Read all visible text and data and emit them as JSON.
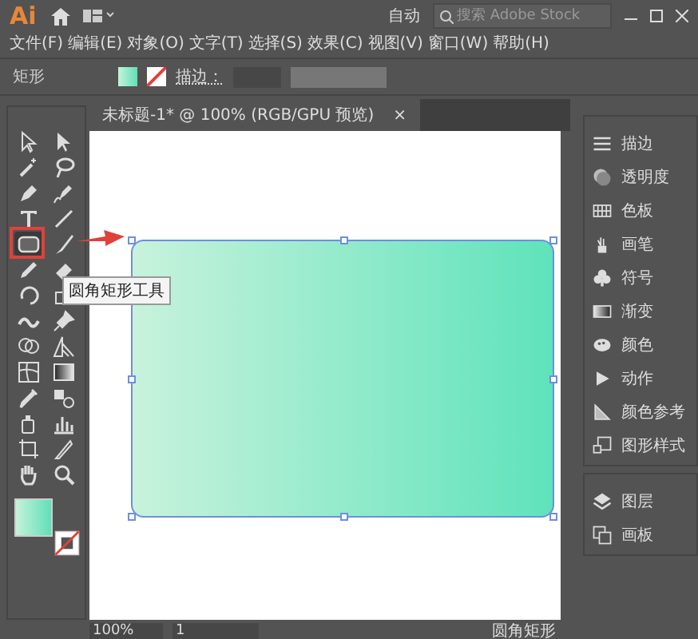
{
  "title_bar": {
    "logo": "Ai",
    "workspace": "自动",
    "search": {
      "placeholder": "搜索 Adobe Stock"
    }
  },
  "menu": [
    "文件(F)",
    "编辑(E)",
    "对象(O)",
    "文字(T)",
    "选择(S)",
    "效果(C)",
    "视图(V)",
    "窗口(W)",
    "帮助(H)"
  ],
  "control_bar": {
    "object_type": "矩形",
    "stroke_label": "描边："
  },
  "tools": [
    {
      "kind": "select",
      "selected": false
    },
    {
      "kind": "direct",
      "selected": false
    },
    {
      "kind": "wand",
      "selected": false
    },
    {
      "kind": "lasso",
      "selected": false
    },
    {
      "kind": "pen",
      "selected": false
    },
    {
      "kind": "curve",
      "selected": false
    },
    {
      "kind": "type",
      "selected": false
    },
    {
      "kind": "line",
      "selected": false
    },
    {
      "kind": "roundrect",
      "selected": true
    },
    {
      "kind": "brush",
      "selected": false
    },
    {
      "kind": "shaper",
      "selected": false
    },
    {
      "kind": "eraser",
      "selected": false
    },
    {
      "kind": "rotate",
      "selected": false
    },
    {
      "kind": "scale",
      "selected": false
    },
    {
      "kind": "warp",
      "selected": false
    },
    {
      "kind": "pin",
      "selected": false
    },
    {
      "kind": "builder",
      "selected": false
    },
    {
      "kind": "perspective",
      "selected": false
    },
    {
      "kind": "mesh",
      "selected": false
    },
    {
      "kind": "gradient",
      "selected": false
    },
    {
      "kind": "eyedropper",
      "selected": false
    },
    {
      "kind": "blend",
      "selected": false
    },
    {
      "kind": "spray",
      "selected": false
    },
    {
      "kind": "graph",
      "selected": false
    },
    {
      "kind": "artboard",
      "selected": false
    },
    {
      "kind": "slice",
      "selected": false
    },
    {
      "kind": "hand",
      "selected": false
    },
    {
      "kind": "zoom",
      "selected": false
    }
  ],
  "tooltip": "圆角矩形工具",
  "document_tab": {
    "title": "未标题-1* @ 100% (RGB/GPU 预览)",
    "close": "×"
  },
  "panels": [
    [
      {
        "kind": "stroke",
        "label": "描边"
      },
      {
        "kind": "opacity",
        "label": "透明度"
      },
      {
        "kind": "swatch",
        "label": "色板"
      },
      {
        "kind": "brush",
        "label": "画笔"
      },
      {
        "kind": "symbol",
        "label": "符号"
      },
      {
        "kind": "gradient",
        "label": "渐变"
      },
      {
        "kind": "color",
        "label": "颜色"
      },
      {
        "kind": "action",
        "label": "动作"
      },
      {
        "kind": "guide",
        "label": "颜色参考"
      },
      {
        "kind": "style",
        "label": "图形样式"
      }
    ],
    [
      {
        "kind": "layers",
        "label": "图层"
      },
      {
        "kind": "artboards",
        "label": "画板"
      }
    ]
  ],
  "status_bar": {
    "zoom": "100%",
    "page": "1",
    "status": "圆角矩形"
  }
}
